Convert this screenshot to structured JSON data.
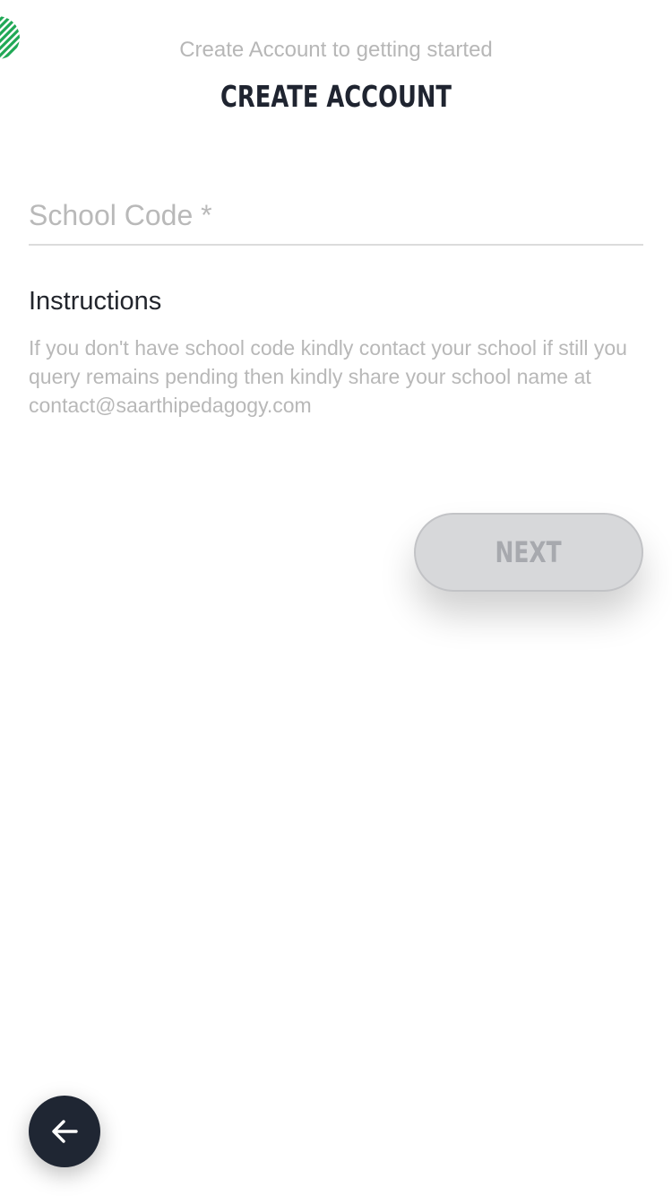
{
  "header": {
    "subtitle": "Create Account to getting started",
    "title": "CREATE ACCOUNT"
  },
  "form": {
    "school_code": {
      "value": "",
      "placeholder": "School Code *"
    }
  },
  "instructions": {
    "heading": "Instructions",
    "body": "If you don't have school code kindly contact your school if still you query remains pending then kindly share your school name at contact@saarthipedagogy.com"
  },
  "actions": {
    "next_label": "NEXT",
    "back_icon": "arrow-left-icon"
  },
  "brand": {
    "logo_icon": "striped-circle-logo",
    "logo_color": "#1fa855"
  },
  "colors": {
    "primary_dark": "#1f2633",
    "disabled_button": "#d7d8da",
    "muted_text": "#b8b8b8"
  }
}
